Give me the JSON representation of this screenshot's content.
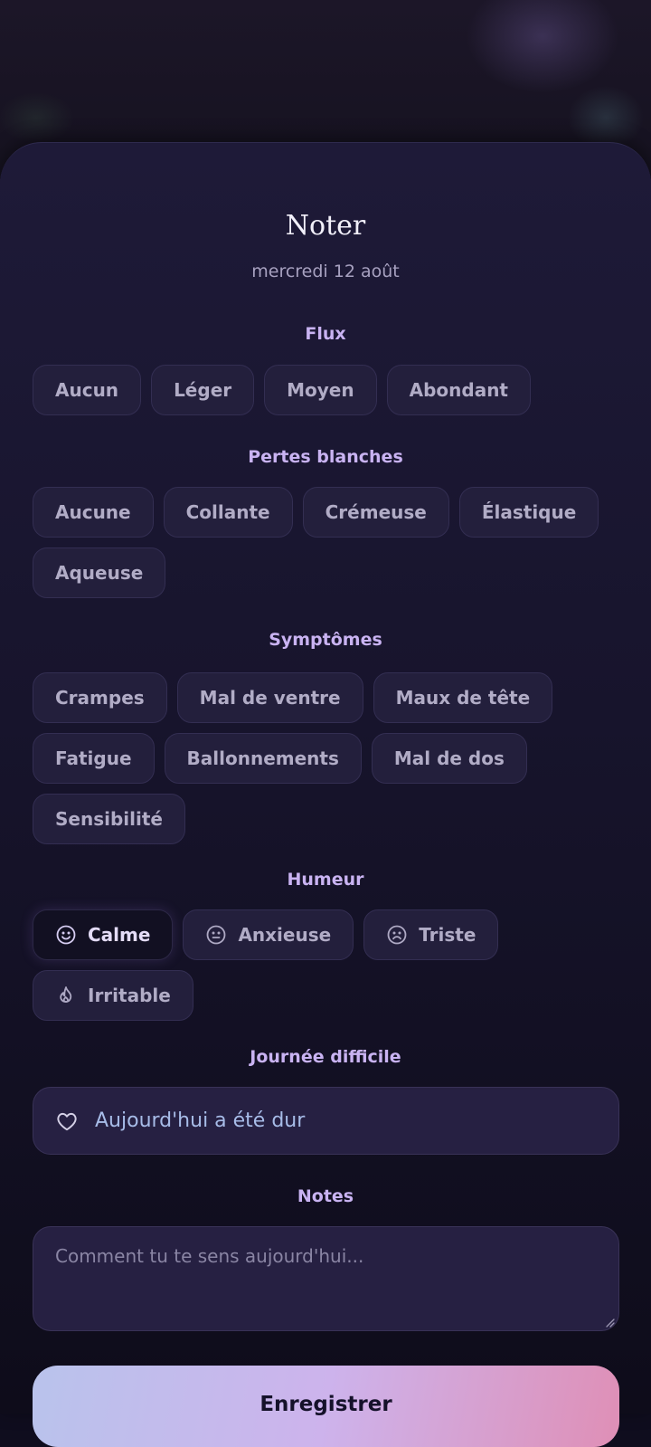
{
  "sheet": {
    "title": "Noter",
    "date": "mercredi 12 août"
  },
  "flow": {
    "title": "Flux",
    "options": [
      "Aucun",
      "Léger",
      "Moyen",
      "Abondant"
    ]
  },
  "discharge": {
    "title": "Pertes blanches",
    "options": [
      "Aucune",
      "Collante",
      "Crémeuse",
      "Élastique",
      "Aqueuse"
    ]
  },
  "symptoms": {
    "title": "Symptômes",
    "options": [
      "Crampes",
      "Mal de ventre",
      "Maux de tête",
      "Fatigue",
      "Ballonnements",
      "Mal de dos",
      "Sensibilité"
    ]
  },
  "mood": {
    "title": "Humeur",
    "selected": "Calme",
    "options": [
      {
        "label": "Calme",
        "icon": "smile-icon"
      },
      {
        "label": "Anxieuse",
        "icon": "neutral-face-icon"
      },
      {
        "label": "Triste",
        "icon": "sad-face-icon"
      },
      {
        "label": "Irritable",
        "icon": "flame-icon"
      }
    ]
  },
  "hard_day": {
    "title": "Journée difficile",
    "label": "Aujourd'hui a été dur",
    "icon": "heart-icon"
  },
  "notes": {
    "title": "Notes",
    "placeholder": "Comment tu te sens aujourd'hui..."
  },
  "save_label": "Enregistrer",
  "colors": {
    "accent": "#c9b3f2",
    "hard_day_text": "#a7bce8",
    "save_gradient_start": "#b9c3ec",
    "save_gradient_end": "#df8fb6"
  }
}
